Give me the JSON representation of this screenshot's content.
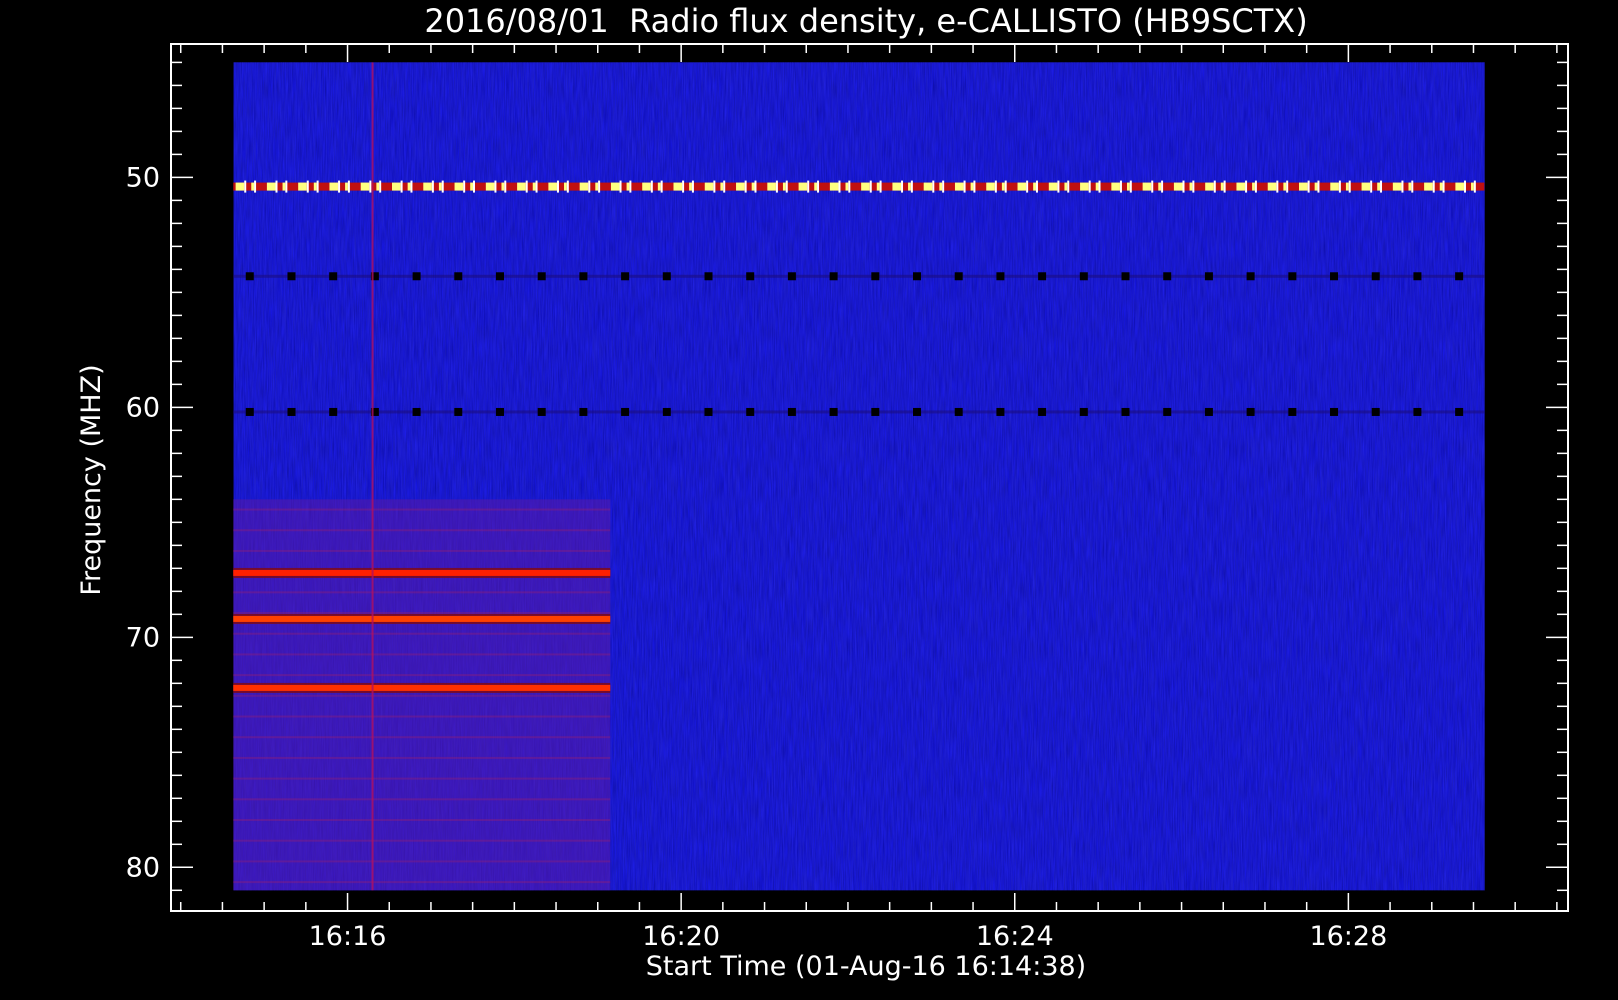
{
  "chart_data": {
    "type": "heatmap",
    "title": "2016/08/01  Radio flux density, e-CALLISTO (HB9SCTX)",
    "xlabel": "Start Time (01-Aug-16 16:14:38)",
    "ylabel": "Frequency (MHZ)",
    "x_axis": {
      "unit": "time",
      "range": [
        "16:14:38",
        "16:29:38"
      ],
      "display_range": [
        "16:13:53",
        "16:30:38"
      ],
      "ticks": [
        "16:16",
        "16:20",
        "16:24",
        "16:28"
      ],
      "tick_minutes": [
        16,
        20,
        24,
        28
      ]
    },
    "y_axis": {
      "unit": "MHz",
      "range": [
        45,
        81
      ],
      "display_range": [
        44.2,
        81.9
      ],
      "inverted": true,
      "ticks": [
        50,
        60,
        70,
        80
      ]
    },
    "colorscale": [
      "#000000",
      "#0000ff",
      "#ff0000",
      "#ffff00",
      "#ffffff"
    ],
    "background_color": "#1414e6",
    "features": [
      {
        "kind": "dashed-carrier",
        "freq_mhz": 50.4,
        "start_min": 14.63,
        "end_min": 29.63,
        "color": "#ffff80"
      },
      {
        "kind": "dotted-dark-line",
        "freq_mhz": 54.3,
        "start_min": 14.63,
        "end_min": 29.63,
        "color": "#000000"
      },
      {
        "kind": "dotted-dark-line",
        "freq_mhz": 60.2,
        "start_min": 14.63,
        "end_min": 29.63,
        "color": "#000000"
      },
      {
        "kind": "band",
        "freq_mhz": 67.2,
        "start_min": 14.63,
        "end_min": 19.15,
        "color": "#ff2000"
      },
      {
        "kind": "band",
        "freq_mhz": 69.2,
        "start_min": 14.63,
        "end_min": 19.15,
        "color": "#ff4000"
      },
      {
        "kind": "band",
        "freq_mhz": 72.2,
        "start_min": 14.63,
        "end_min": 19.15,
        "color": "#ff3000"
      },
      {
        "kind": "vertical-spike",
        "time_min": 16.3,
        "freq_range": [
          45,
          81
        ],
        "color": "#b01060"
      }
    ],
    "elevated_region": {
      "start_min": 14.63,
      "end_min": 19.15,
      "freq_range": [
        64,
        81
      ],
      "color": "#5a1aa8"
    },
    "grid": false,
    "legend": "none"
  }
}
